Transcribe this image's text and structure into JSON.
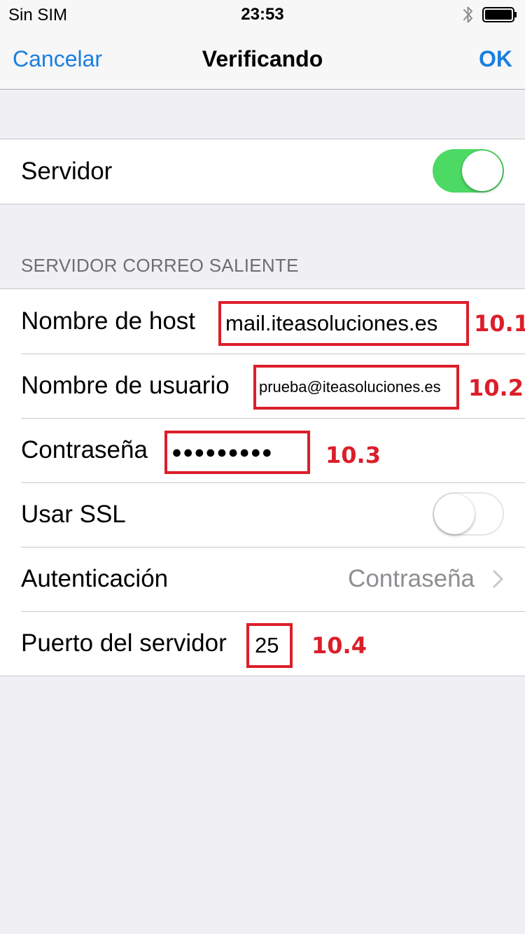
{
  "status_bar": {
    "carrier": "Sin SIM",
    "time": "23:53",
    "icons": [
      "bluetooth-icon",
      "battery-icon"
    ]
  },
  "nav": {
    "cancel_label": "Cancelar",
    "title": "Verificando",
    "ok_label": "OK"
  },
  "server_row": {
    "label": "Servidor",
    "enabled": true
  },
  "outgoing": {
    "header": "SERVIDOR CORREO SALIENTE",
    "hostname": {
      "label": "Nombre de host",
      "value": "mail.iteasoluciones.es",
      "annotation": "10.1"
    },
    "username": {
      "label": "Nombre de usuario",
      "value": "prueba@iteasoluciones.es",
      "annotation": "10.2"
    },
    "password": {
      "label": "Contraseña",
      "value": "●●●●●●●●●",
      "annotation": "10.3"
    },
    "ssl": {
      "label": "Usar SSL",
      "enabled": false
    },
    "auth": {
      "label": "Autenticación",
      "value": "Contraseña"
    },
    "port": {
      "label": "Puerto del servidor",
      "value": "25",
      "annotation": "10.4"
    }
  },
  "colors": {
    "accent": "#1a7fe0",
    "toggle_on": "#4cd964",
    "annotation_red": "#dc1e2a",
    "background": "#efeff4"
  }
}
